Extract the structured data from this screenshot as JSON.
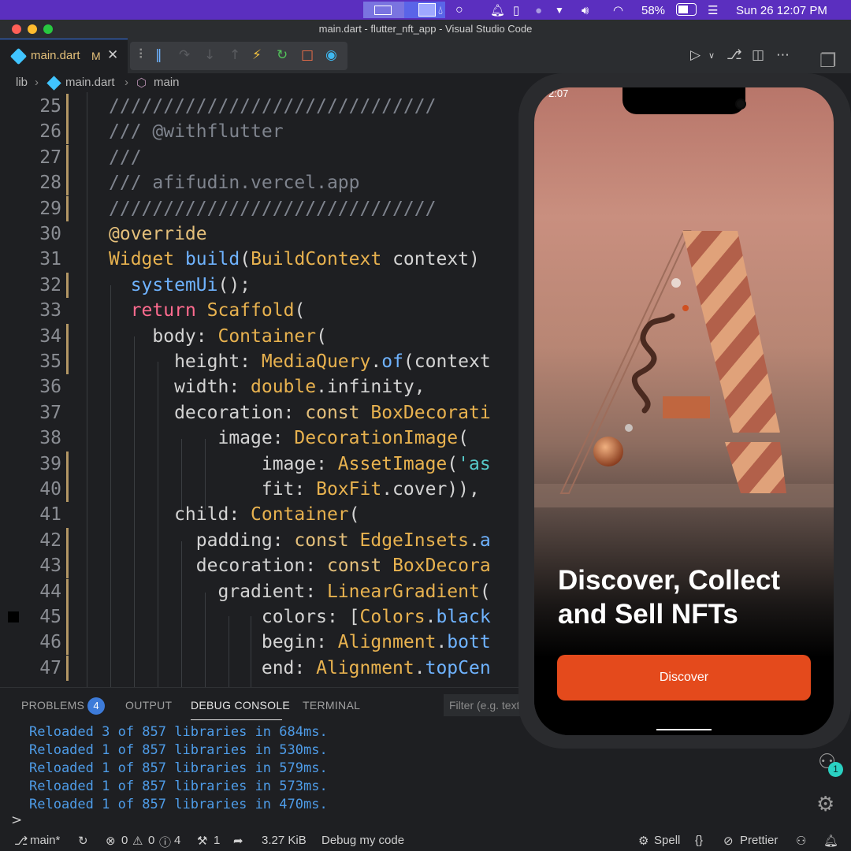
{
  "menubar": {
    "battery_percent": "58%",
    "datetime": "Sun 26  12:07 PM"
  },
  "window": {
    "title": "main.dart - flutter_nft_app - Visual Studio Code"
  },
  "editor_tab": {
    "label": "main.dart",
    "modified_flag": "M"
  },
  "breadcrumb": {
    "folder": "lib",
    "file": "main.dart",
    "symbol": "main"
  },
  "code_lines": [
    {
      "n": "25",
      "html": "<span class=\"c-cmt\">//////////////////////////////</span>"
    },
    {
      "n": "26",
      "html": "<span class=\"c-cmt\">/// @withflutter</span>"
    },
    {
      "n": "27",
      "html": "<span class=\"c-cmt\">///</span>"
    },
    {
      "n": "28",
      "html": "<span class=\"c-cmt\">/// afifudin.vercel.app</span>"
    },
    {
      "n": "29",
      "html": "<span class=\"c-cmt\">//////////////////////////////</span>"
    },
    {
      "n": "30",
      "html": "<span class=\"c-kw\">@override</span>"
    },
    {
      "n": "31",
      "html": "<span class=\"c-cls\">Widget</span> <span class=\"c-fn\">build</span>(<span class=\"c-cls\">BuildContext</span> context)"
    },
    {
      "n": "32",
      "html": "  <span class=\"c-fn\">systemUi</span>();"
    },
    {
      "n": "33",
      "html": "  <span class=\"c-ret\">return</span> <span class=\"c-cls\">Scaffold</span>("
    },
    {
      "n": "34",
      "html": "    body: <span class=\"c-cls\">Container</span>("
    },
    {
      "n": "35",
      "html": "      height: <span class=\"c-cls\">MediaQuery</span>.<span class=\"c-fn\">of</span>(context"
    },
    {
      "n": "36",
      "html": "      width: <span class=\"c-cls\">double</span>.infinity,"
    },
    {
      "n": "37",
      "html": "      decoration: <span class=\"c-kw\">const</span> <span class=\"c-cls\">BoxDecorati</span>"
    },
    {
      "n": "38",
      "html": "          image: <span class=\"c-cls\">DecorationImage</span>("
    },
    {
      "n": "39",
      "html": "              image: <span class=\"c-cls\">AssetImage</span>(<span class=\"c-str\">'as</span>"
    },
    {
      "n": "40",
      "html": "              fit: <span class=\"c-cls\">BoxFit</span>.cover)),"
    },
    {
      "n": "41",
      "html": "      child: <span class=\"c-cls\">Container</span>("
    },
    {
      "n": "42",
      "html": "        padding: <span class=\"c-kw\">const</span> <span class=\"c-cls\">EdgeInsets</span>.<span class=\"c-fn\">a</span>"
    },
    {
      "n": "43",
      "html": "        decoration: <span class=\"c-kw\">const</span> <span class=\"c-cls\">BoxDecora</span>"
    },
    {
      "n": "44",
      "html": "          gradient: <span class=\"c-cls\">LinearGradient</span>("
    },
    {
      "n": "45",
      "html": "              colors: [<span class=\"c-cls\">Colors</span>.<span class=\"c-fn\">black</span>"
    },
    {
      "n": "46",
      "html": "              begin: <span class=\"c-cls\">Alignment</span>.<span class=\"c-fn\">bott</span>"
    },
    {
      "n": "47",
      "html": "              end: <span class=\"c-cls\">Alignment</span>.<span class=\"c-fn\">topCen</span>"
    }
  ],
  "panel": {
    "tabs": [
      "PROBLEMS",
      "OUTPUT",
      "DEBUG CONSOLE",
      "TERMINAL"
    ],
    "problems_count": "4",
    "filter_placeholder": "Filter (e.g. text",
    "console_lines": [
      "Reloaded 3 of 857 libraries in 684ms.",
      "Reloaded 1 of 857 libraries in 530ms.",
      "Reloaded 1 of 857 libraries in 579ms.",
      "Reloaded 1 of 857 libraries in 573ms.",
      "Reloaded 1 of 857 libraries in 470ms."
    ],
    "prompt": ">"
  },
  "statusbar": {
    "branch": "main*",
    "errors": "0",
    "warnings": "0",
    "infos": "4",
    "ports": "1",
    "size": "3.27 KiB",
    "debug": "Debug my code",
    "spell": "Spell",
    "prettier": "Prettier"
  },
  "accounts_badge": "1",
  "phone": {
    "status_time": "2:07",
    "headline": "Discover, Collect and Sell NFTs",
    "button": "Discover"
  },
  "colors": {
    "accent_button": "#e44a1c",
    "menubar": "#5b2fbf",
    "console_text": "#4e9ce8"
  }
}
